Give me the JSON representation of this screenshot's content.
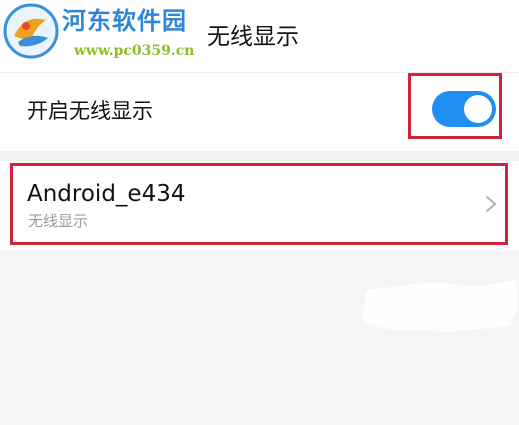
{
  "header": {
    "title": "无线显示",
    "back_icon": "chevron-left-icon"
  },
  "watermark": {
    "name": "河东软件园",
    "url": "www.pc0359.cn",
    "logo_icon": "site-logo-icon"
  },
  "wireless_display": {
    "label": "开启无线显示",
    "enabled": true,
    "accent_color": "#1e8ff0"
  },
  "devices": [
    {
      "name": "Android_e434",
      "subtitle": "无线显示",
      "arrow_icon": "chevron-right-icon"
    }
  ],
  "highlight_color": "#d0243a"
}
